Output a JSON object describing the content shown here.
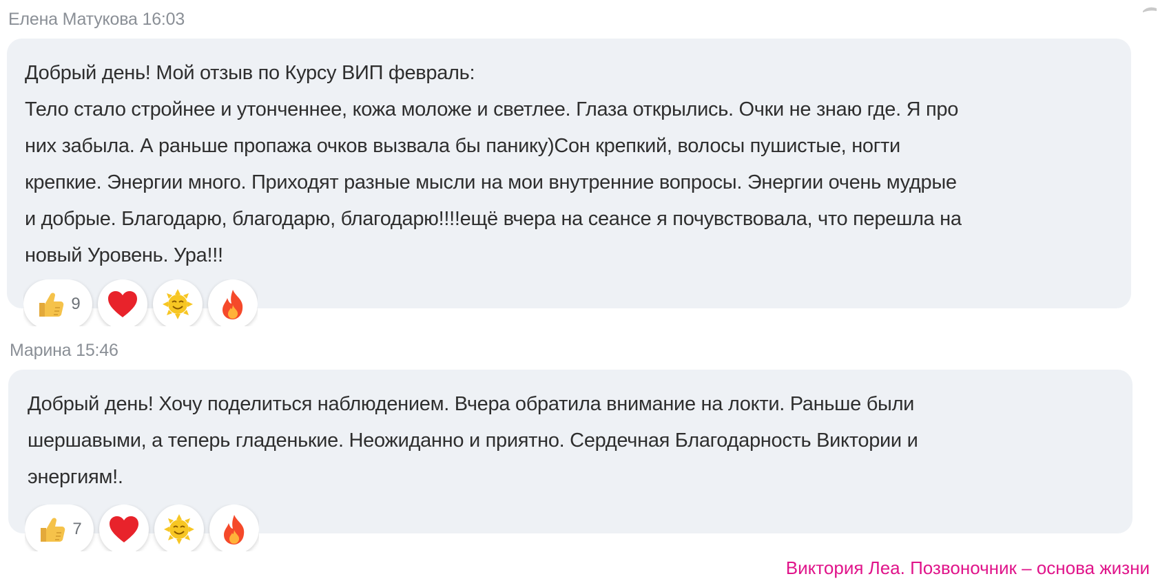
{
  "messages": [
    {
      "author": "Елена Матукова",
      "time": "16:03",
      "text": "Добрый день! Мой отзыв по Курсу ВИП февраль:\nТело стало стройнее и утонченнее, кожа моложе и светлее. Глаза открылись. Очки не знаю где. Я про\nних забыла. А раньше пропажа очков вызвала бы панику)Сон крепкий, волосы пушистые, ногти\nкрепкие. Энергии много. Приходят разные мысли на мои внутренние вопросы. Энергии очень мудрые\nи добрые. Благодарю, благодарю, благодарю!!!!ещё вчера на сеансе я почувствовала, что перешла на\nновый Уровень. Ура!!!",
      "reactions": [
        {
          "icon": "thumbs-up-icon",
          "count": "9"
        },
        {
          "icon": "heart-icon",
          "count": ""
        },
        {
          "icon": "sun-smile-icon",
          "count": ""
        },
        {
          "icon": "fire-icon",
          "count": ""
        }
      ]
    },
    {
      "author": "Марина",
      "time": "15:46",
      "text": "Добрый день! Хочу поделиться наблюдением. Вчера обратила внимание на локти. Раньше были\nшершавыми, а теперь гладенькие. Неожиданно и приятно. Сердечная Благодарность Виктории и\nэнергиям!.",
      "reactions": [
        {
          "icon": "thumbs-up-icon",
          "count": "7"
        },
        {
          "icon": "heart-icon",
          "count": ""
        },
        {
          "icon": "sun-smile-icon",
          "count": ""
        },
        {
          "icon": "fire-icon",
          "count": ""
        }
      ]
    }
  ],
  "watermark": "Виктория Леа. Позвоночник – основа жизни",
  "colors": {
    "bubble": "#eef1f5",
    "meta": "#8a8f96",
    "watermark": "#e0148a",
    "heart": "#e8232b",
    "thumb": "#f5c24a",
    "sun": "#f7c623",
    "fire": "#f5492a"
  }
}
